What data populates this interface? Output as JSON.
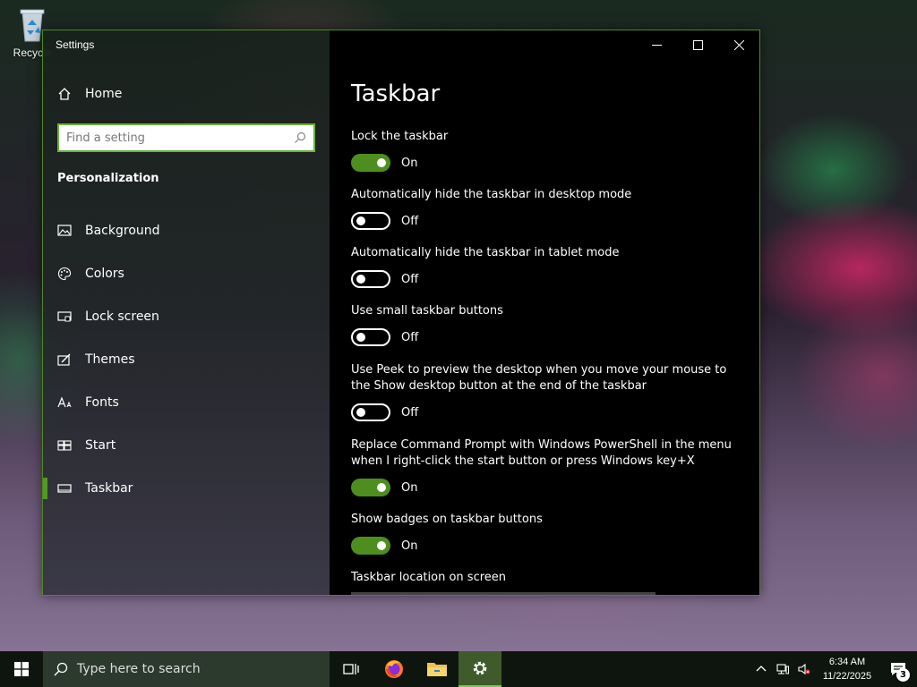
{
  "desktop": {
    "recycle_bin_label": "Recycle"
  },
  "window": {
    "title": "Settings"
  },
  "sidebar": {
    "home_label": "Home",
    "search_placeholder": "Find a setting",
    "section_title": "Personalization",
    "items": [
      {
        "label": "Background",
        "icon": "image-icon"
      },
      {
        "label": "Colors",
        "icon": "palette-icon"
      },
      {
        "label": "Lock screen",
        "icon": "lock-screen-icon"
      },
      {
        "label": "Themes",
        "icon": "themes-icon"
      },
      {
        "label": "Fonts",
        "icon": "fonts-icon"
      },
      {
        "label": "Start",
        "icon": "start-tiles-icon"
      },
      {
        "label": "Taskbar",
        "icon": "taskbar-icon",
        "active": true
      }
    ]
  },
  "main": {
    "page_title": "Taskbar",
    "settings": [
      {
        "label": "Lock the taskbar",
        "state": "On"
      },
      {
        "label": "Automatically hide the taskbar in desktop mode",
        "state": "Off"
      },
      {
        "label": "Automatically hide the taskbar in tablet mode",
        "state": "Off"
      },
      {
        "label": "Use small taskbar buttons",
        "state": "Off"
      },
      {
        "label": "Use Peek to preview the desktop when you move your mouse to the Show desktop button at the end of the taskbar",
        "state": "Off"
      },
      {
        "label": "Replace Command Prompt with Windows PowerShell in the menu when I right-click the start button or press Windows key+X",
        "state": "On"
      },
      {
        "label": "Show badges on taskbar buttons",
        "state": "On"
      }
    ],
    "location_label": "Taskbar location on screen"
  },
  "taskbar": {
    "search_text": "Type here to search",
    "time": "6:34 AM",
    "date": "11/22/2025",
    "notification_count": "3"
  },
  "colors": {
    "accent": "#4e8e1f",
    "content_bg": "#000000"
  }
}
